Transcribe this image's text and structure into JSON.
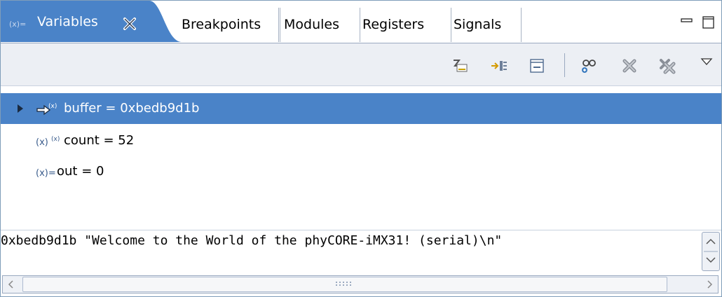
{
  "tabs": {
    "active": {
      "label": "Variables",
      "icon": "variables-icon"
    },
    "others": [
      {
        "label": "Breakpoints"
      },
      {
        "label": "Modules"
      },
      {
        "label": "Registers"
      },
      {
        "label": "Signals"
      }
    ]
  },
  "toolbar": {
    "icons": [
      "show-type-names-icon",
      "show-logical-structure-icon",
      "collapse-all-icon",
      "add-watch-icon",
      "remove-icon",
      "remove-all-icon",
      "view-menu-icon"
    ]
  },
  "variables": [
    {
      "name": "buffer",
      "value": "0xbedb9d1b",
      "text": "buffer = 0xbedb9d1b",
      "icon": "pointer-variable-icon",
      "expandable": true,
      "selected": true
    },
    {
      "name": "count",
      "value": "52",
      "text": "count = 52",
      "icon": "local-variable-icon",
      "expandable": false,
      "selected": false
    },
    {
      "name": "out",
      "value": "0",
      "text": "out = 0",
      "icon": "variable-icon",
      "expandable": false,
      "selected": false
    }
  ],
  "detail": {
    "text": "0xbedb9d1b \"Welcome to the World of the phyCORE-iMX31! (serial)\\n\""
  },
  "colors": {
    "selection": "#4a83c8",
    "active_tab": "#4a83c8",
    "toolbar_bg": "#eceff4"
  }
}
